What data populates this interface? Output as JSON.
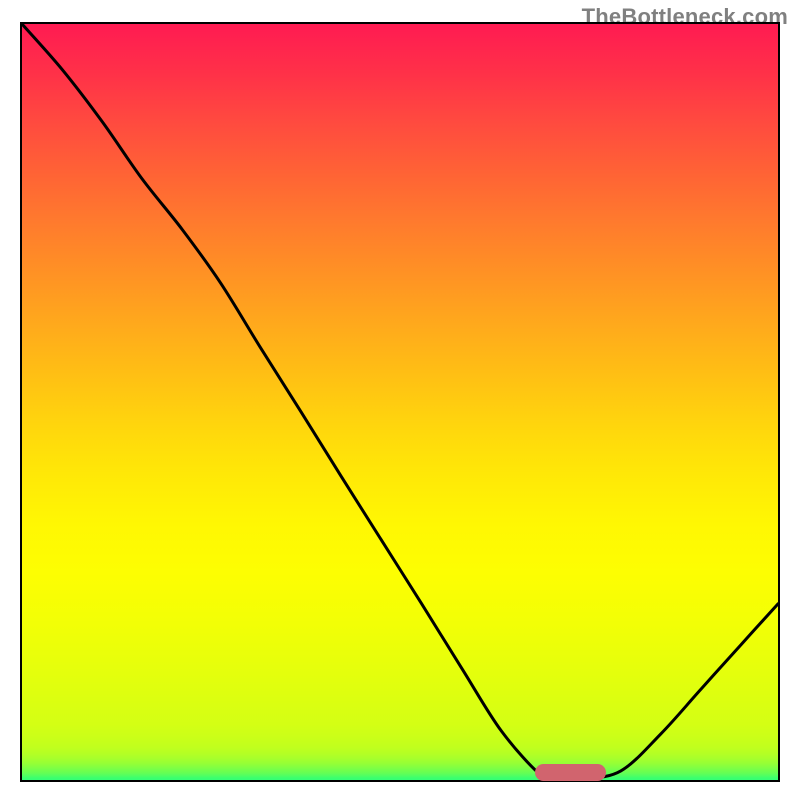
{
  "attribution": "TheBottleneck.com",
  "colors": {
    "frame": "#000000",
    "curve": "#000000",
    "marker": "#d1646e",
    "gradient_top": "#ff1b52",
    "gradient_bottom": "#34ff73"
  },
  "chart_data": {
    "type": "line",
    "title": "",
    "xlabel": "",
    "ylabel": "",
    "xlim": [
      0,
      100
    ],
    "ylim": [
      0,
      100
    ],
    "series": [
      {
        "name": "bottleneck-curve",
        "x": [
          0.0,
          5.3,
          10.6,
          15.9,
          21.2,
          26.3,
          31.6,
          36.9,
          42.2,
          47.5,
          52.8,
          58.1,
          63.4,
          68.7,
          71.3,
          74.0,
          79.2,
          84.5,
          89.8,
          95.1,
          100.0
        ],
        "y": [
          100.0,
          94.0,
          87.1,
          79.5,
          72.8,
          65.7,
          57.1,
          48.7,
          40.2,
          31.8,
          23.4,
          14.9,
          6.5,
          0.6,
          0.1,
          0.1,
          1.2,
          6.1,
          12.0,
          17.9,
          23.3
        ]
      }
    ],
    "marker": {
      "shape": "rounded-rect",
      "x_center": 72.6,
      "y_center": 0.95,
      "width_pct": 9.4,
      "height_pct": 2.25
    },
    "notes": "No axis ticks or gridlines are rendered; values are read proportionally from the 0–100 frame."
  }
}
